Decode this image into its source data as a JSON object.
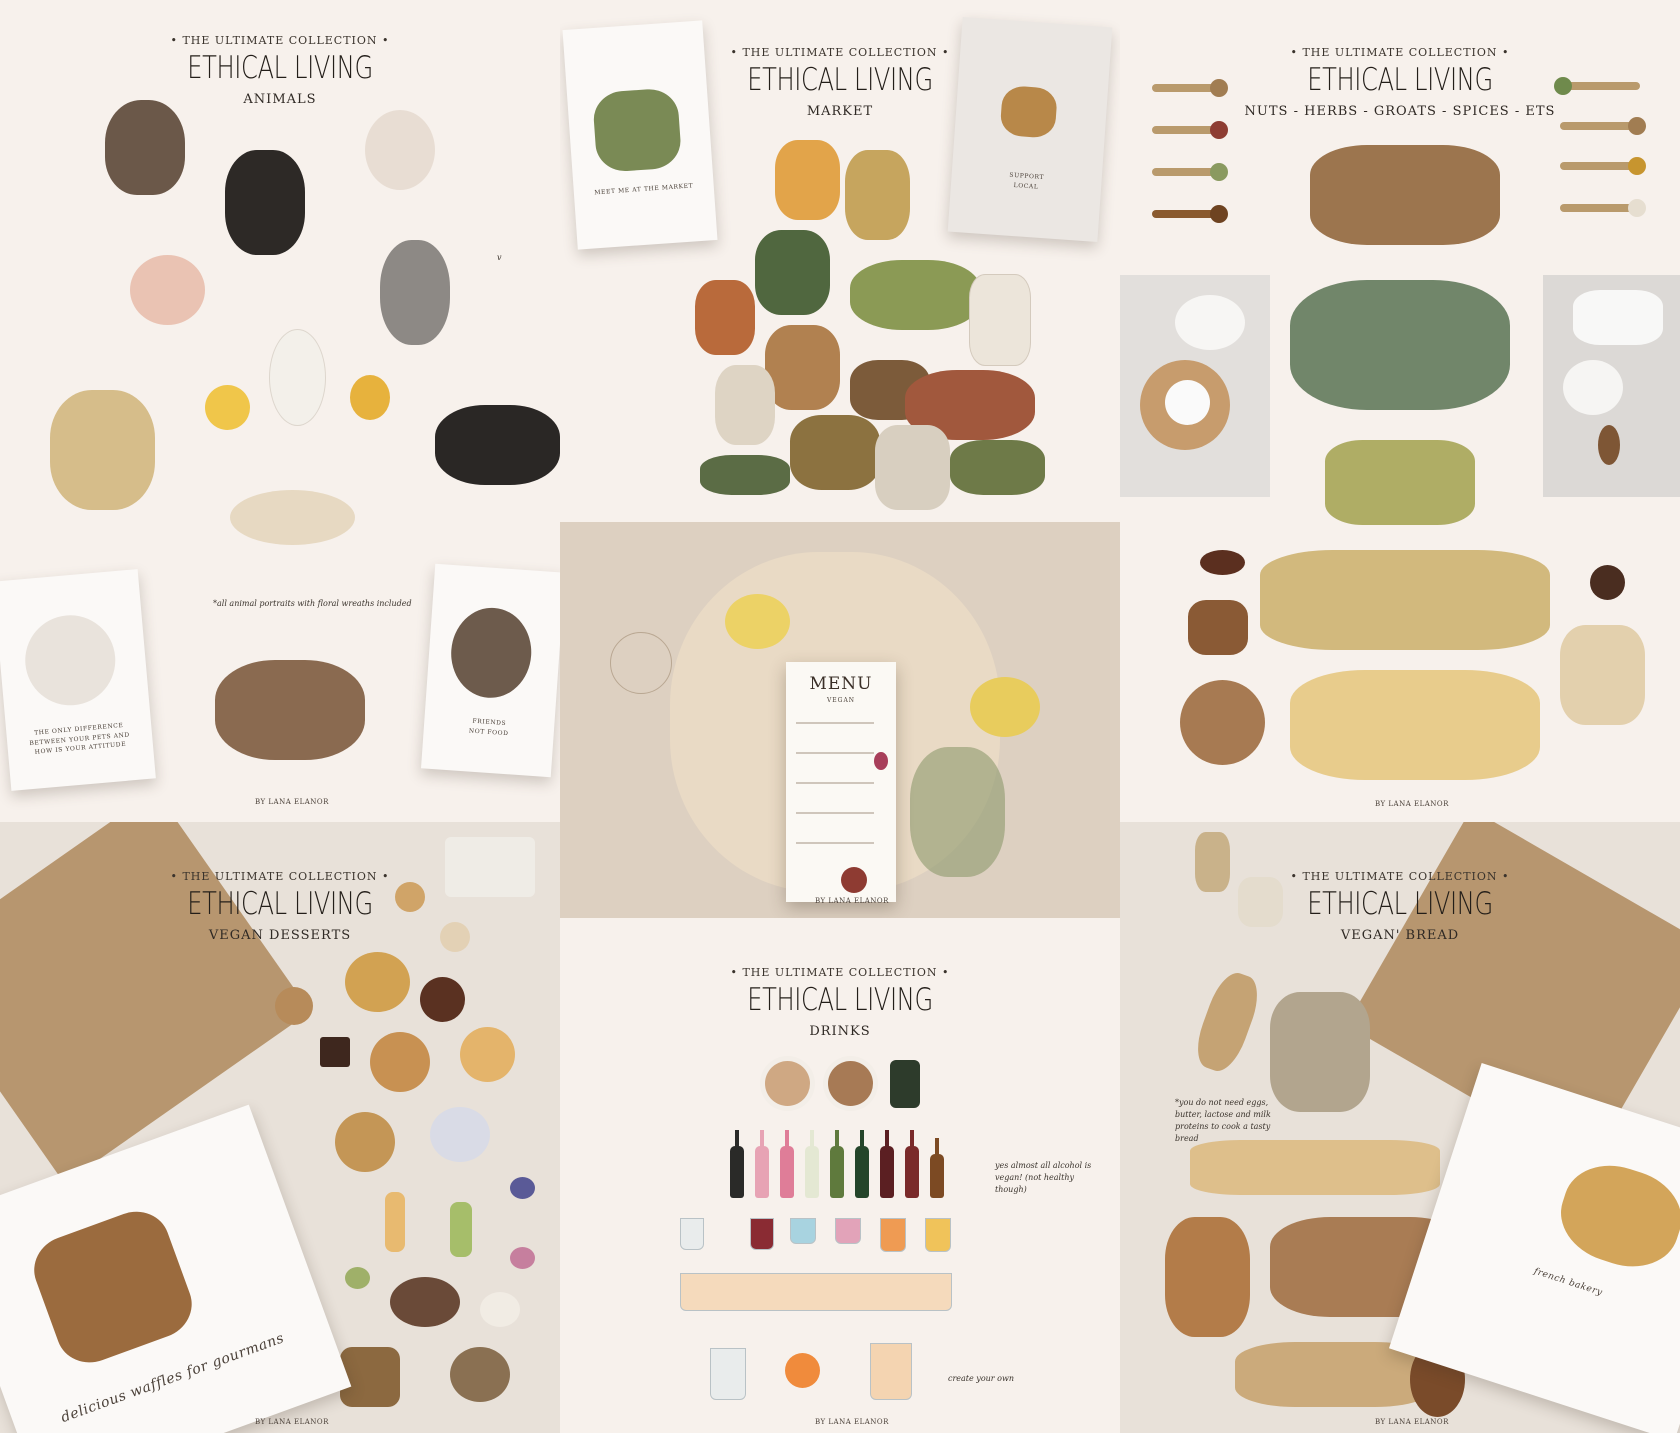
{
  "panels": {
    "animals": {
      "kicker": "• THE ULTIMATE COLLECTION •",
      "brand": "ETHICAL LIVING",
      "subtitle": "ANIMALS",
      "note": "*all animal portraits with floral wreaths included",
      "stray": "v",
      "card_left_text": "THE ONLY DIFFERENCE BETWEEN YOUR PETS AND HOW IS YOUR ATTITUDE",
      "card_right_text": "FRIENDS NOT FOOD",
      "credit": "BY LANA ELANOR"
    },
    "market": {
      "kicker": "• THE ULTIMATE COLLECTION •",
      "brand": "ETHICAL LIVING",
      "subtitle": "MARKET",
      "card_left_text": "MEET ME AT THE MARKET",
      "card_right_text": "SUPPORT LOCAL"
    },
    "nuts": {
      "kicker": "• THE ULTIMATE COLLECTION •",
      "brand": "ETHICAL LIVING",
      "subtitle": "NUTS - HERBS - GROATS - SPICES - ETS",
      "credit": "BY LANA ELANOR"
    },
    "menu": {
      "title": "MENU",
      "subtitle": "VEGAN",
      "credit": "BY LANA ELANOR"
    },
    "desserts": {
      "kicker": "• THE ULTIMATE COLLECTION •",
      "brand": "ETHICAL LIVING",
      "subtitle": "VEGAN DESSERTS",
      "card_text": "delicious waffles for gourmans",
      "credit": "BY LANA ELANOR"
    },
    "drinks": {
      "kicker": "• THE ULTIMATE COLLECTION •",
      "brand": "ETHICAL LIVING",
      "subtitle": "DRINKS",
      "note1": "yes almost all alcohol is vegan! (not healthy though)",
      "note2": "create your own",
      "credit": "BY LANA ELANOR"
    },
    "bread": {
      "kicker": "• THE ULTIMATE COLLECTION •",
      "brand": "ETHICAL LIVING",
      "subtitle": "VEGAN' BREAD",
      "note": "*you do not need eggs, butter, lactose and milk proteins to cook a tasty bread",
      "card_text": "french bakery",
      "credit": "BY LANA ELANOR"
    }
  },
  "colors": {
    "cream": "#f7f1ec",
    "linen": "#ddd0c1",
    "kraft": "#b7966f",
    "ink": "#231e19"
  }
}
